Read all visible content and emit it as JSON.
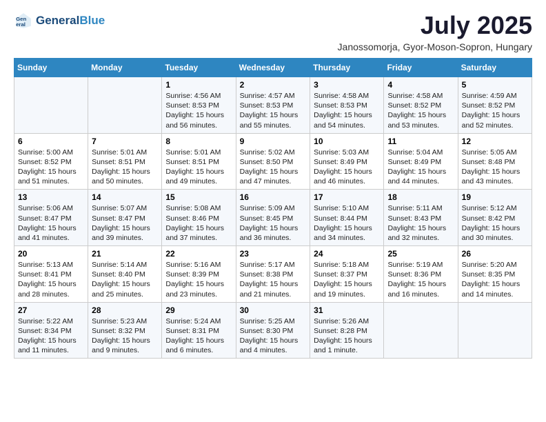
{
  "logo": {
    "line1": "General",
    "line2": "Blue"
  },
  "title": "July 2025",
  "subtitle": "Janossomorja, Gyor-Moson-Sopron, Hungary",
  "days_of_week": [
    "Sunday",
    "Monday",
    "Tuesday",
    "Wednesday",
    "Thursday",
    "Friday",
    "Saturday"
  ],
  "weeks": [
    [
      {
        "day": "",
        "sunrise": "",
        "sunset": "",
        "daylight": ""
      },
      {
        "day": "",
        "sunrise": "",
        "sunset": "",
        "daylight": ""
      },
      {
        "day": "1",
        "sunrise": "Sunrise: 4:56 AM",
        "sunset": "Sunset: 8:53 PM",
        "daylight": "Daylight: 15 hours and 56 minutes."
      },
      {
        "day": "2",
        "sunrise": "Sunrise: 4:57 AM",
        "sunset": "Sunset: 8:53 PM",
        "daylight": "Daylight: 15 hours and 55 minutes."
      },
      {
        "day": "3",
        "sunrise": "Sunrise: 4:58 AM",
        "sunset": "Sunset: 8:53 PM",
        "daylight": "Daylight: 15 hours and 54 minutes."
      },
      {
        "day": "4",
        "sunrise": "Sunrise: 4:58 AM",
        "sunset": "Sunset: 8:52 PM",
        "daylight": "Daylight: 15 hours and 53 minutes."
      },
      {
        "day": "5",
        "sunrise": "Sunrise: 4:59 AM",
        "sunset": "Sunset: 8:52 PM",
        "daylight": "Daylight: 15 hours and 52 minutes."
      }
    ],
    [
      {
        "day": "6",
        "sunrise": "Sunrise: 5:00 AM",
        "sunset": "Sunset: 8:52 PM",
        "daylight": "Daylight: 15 hours and 51 minutes."
      },
      {
        "day": "7",
        "sunrise": "Sunrise: 5:01 AM",
        "sunset": "Sunset: 8:51 PM",
        "daylight": "Daylight: 15 hours and 50 minutes."
      },
      {
        "day": "8",
        "sunrise": "Sunrise: 5:01 AM",
        "sunset": "Sunset: 8:51 PM",
        "daylight": "Daylight: 15 hours and 49 minutes."
      },
      {
        "day": "9",
        "sunrise": "Sunrise: 5:02 AM",
        "sunset": "Sunset: 8:50 PM",
        "daylight": "Daylight: 15 hours and 47 minutes."
      },
      {
        "day": "10",
        "sunrise": "Sunrise: 5:03 AM",
        "sunset": "Sunset: 8:49 PM",
        "daylight": "Daylight: 15 hours and 46 minutes."
      },
      {
        "day": "11",
        "sunrise": "Sunrise: 5:04 AM",
        "sunset": "Sunset: 8:49 PM",
        "daylight": "Daylight: 15 hours and 44 minutes."
      },
      {
        "day": "12",
        "sunrise": "Sunrise: 5:05 AM",
        "sunset": "Sunset: 8:48 PM",
        "daylight": "Daylight: 15 hours and 43 minutes."
      }
    ],
    [
      {
        "day": "13",
        "sunrise": "Sunrise: 5:06 AM",
        "sunset": "Sunset: 8:47 PM",
        "daylight": "Daylight: 15 hours and 41 minutes."
      },
      {
        "day": "14",
        "sunrise": "Sunrise: 5:07 AM",
        "sunset": "Sunset: 8:47 PM",
        "daylight": "Daylight: 15 hours and 39 minutes."
      },
      {
        "day": "15",
        "sunrise": "Sunrise: 5:08 AM",
        "sunset": "Sunset: 8:46 PM",
        "daylight": "Daylight: 15 hours and 37 minutes."
      },
      {
        "day": "16",
        "sunrise": "Sunrise: 5:09 AM",
        "sunset": "Sunset: 8:45 PM",
        "daylight": "Daylight: 15 hours and 36 minutes."
      },
      {
        "day": "17",
        "sunrise": "Sunrise: 5:10 AM",
        "sunset": "Sunset: 8:44 PM",
        "daylight": "Daylight: 15 hours and 34 minutes."
      },
      {
        "day": "18",
        "sunrise": "Sunrise: 5:11 AM",
        "sunset": "Sunset: 8:43 PM",
        "daylight": "Daylight: 15 hours and 32 minutes."
      },
      {
        "day": "19",
        "sunrise": "Sunrise: 5:12 AM",
        "sunset": "Sunset: 8:42 PM",
        "daylight": "Daylight: 15 hours and 30 minutes."
      }
    ],
    [
      {
        "day": "20",
        "sunrise": "Sunrise: 5:13 AM",
        "sunset": "Sunset: 8:41 PM",
        "daylight": "Daylight: 15 hours and 28 minutes."
      },
      {
        "day": "21",
        "sunrise": "Sunrise: 5:14 AM",
        "sunset": "Sunset: 8:40 PM",
        "daylight": "Daylight: 15 hours and 25 minutes."
      },
      {
        "day": "22",
        "sunrise": "Sunrise: 5:16 AM",
        "sunset": "Sunset: 8:39 PM",
        "daylight": "Daylight: 15 hours and 23 minutes."
      },
      {
        "day": "23",
        "sunrise": "Sunrise: 5:17 AM",
        "sunset": "Sunset: 8:38 PM",
        "daylight": "Daylight: 15 hours and 21 minutes."
      },
      {
        "day": "24",
        "sunrise": "Sunrise: 5:18 AM",
        "sunset": "Sunset: 8:37 PM",
        "daylight": "Daylight: 15 hours and 19 minutes."
      },
      {
        "day": "25",
        "sunrise": "Sunrise: 5:19 AM",
        "sunset": "Sunset: 8:36 PM",
        "daylight": "Daylight: 15 hours and 16 minutes."
      },
      {
        "day": "26",
        "sunrise": "Sunrise: 5:20 AM",
        "sunset": "Sunset: 8:35 PM",
        "daylight": "Daylight: 15 hours and 14 minutes."
      }
    ],
    [
      {
        "day": "27",
        "sunrise": "Sunrise: 5:22 AM",
        "sunset": "Sunset: 8:34 PM",
        "daylight": "Daylight: 15 hours and 11 minutes."
      },
      {
        "day": "28",
        "sunrise": "Sunrise: 5:23 AM",
        "sunset": "Sunset: 8:32 PM",
        "daylight": "Daylight: 15 hours and 9 minutes."
      },
      {
        "day": "29",
        "sunrise": "Sunrise: 5:24 AM",
        "sunset": "Sunset: 8:31 PM",
        "daylight": "Daylight: 15 hours and 6 minutes."
      },
      {
        "day": "30",
        "sunrise": "Sunrise: 5:25 AM",
        "sunset": "Sunset: 8:30 PM",
        "daylight": "Daylight: 15 hours and 4 minutes."
      },
      {
        "day": "31",
        "sunrise": "Sunrise: 5:26 AM",
        "sunset": "Sunset: 8:28 PM",
        "daylight": "Daylight: 15 hours and 1 minute."
      },
      {
        "day": "",
        "sunrise": "",
        "sunset": "",
        "daylight": ""
      },
      {
        "day": "",
        "sunrise": "",
        "sunset": "",
        "daylight": ""
      }
    ]
  ]
}
